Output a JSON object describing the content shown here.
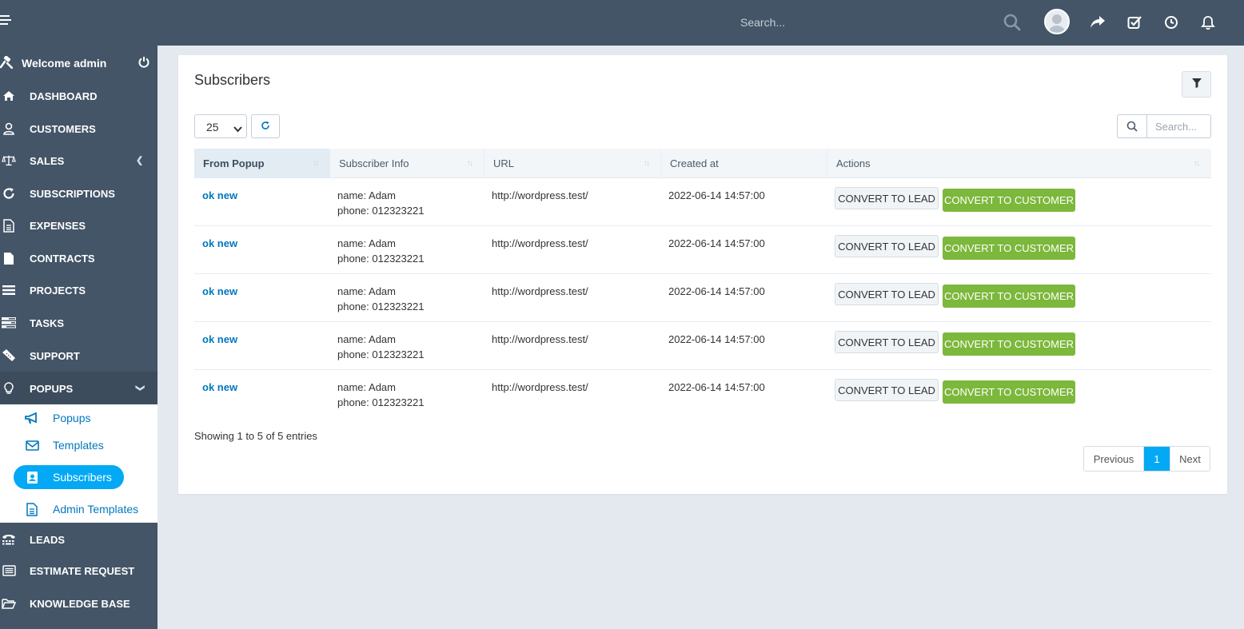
{
  "topbar": {
    "search_placeholder": "Search...",
    "icons": [
      "menu-icon",
      "search-icon",
      "share-icon",
      "check-square-icon",
      "clock-icon",
      "bell-icon"
    ]
  },
  "sidebar": {
    "welcome": "Welcome admin",
    "items": [
      {
        "label": "DASHBOARD",
        "icon": "home-icon"
      },
      {
        "label": "CUSTOMERS",
        "icon": "user-icon"
      },
      {
        "label": "SALES",
        "icon": "balance-scale-icon"
      },
      {
        "label": "SUBSCRIPTIONS",
        "icon": "refresh-icon"
      },
      {
        "label": "EXPENSES",
        "icon": "file-text-icon"
      },
      {
        "label": "CONTRACTS",
        "icon": "file-icon"
      },
      {
        "label": "PROJECTS",
        "icon": "bars-icon"
      },
      {
        "label": "TASKS",
        "icon": "tasks-icon"
      },
      {
        "label": "SUPPORT",
        "icon": "ticket-icon"
      },
      {
        "label": "POPUPS",
        "icon": "lightbulb-icon"
      },
      {
        "label": "LEADS",
        "icon": "tty-icon"
      },
      {
        "label": "ESTIMATE REQUEST",
        "icon": "list-alt-icon"
      },
      {
        "label": "KNOWLEDGE BASE",
        "icon": "folder-open-icon"
      }
    ],
    "submenu": [
      {
        "label": "Popups",
        "icon": "bullhorn-icon"
      },
      {
        "label": "Templates",
        "icon": "envelope-icon"
      },
      {
        "label": "Subscribers",
        "icon": "address-book-icon"
      },
      {
        "label": "Admin Templates",
        "icon": "file-text-icon"
      }
    ]
  },
  "panel": {
    "title": "Subscribers",
    "page_length": "25",
    "search_placeholder": "Search...",
    "columns": [
      "From Popup",
      "Subscriber Info",
      "URL",
      "Created at",
      "Actions"
    ],
    "rows": [
      {
        "popup": "ok new",
        "name": "name: Adam",
        "phone": "phone: 012323221",
        "url": "http://wordpress.test/",
        "created": "2022-06-14 14:57:00"
      },
      {
        "popup": "ok new",
        "name": "name: Adam",
        "phone": "phone: 012323221",
        "url": "http://wordpress.test/",
        "created": "2022-06-14 14:57:00"
      },
      {
        "popup": "ok new",
        "name": "name: Adam",
        "phone": "phone: 012323221",
        "url": "http://wordpress.test/",
        "created": "2022-06-14 14:57:00"
      },
      {
        "popup": "ok new",
        "name": "name: Adam",
        "phone": "phone: 012323221",
        "url": "http://wordpress.test/",
        "created": "2022-06-14 14:57:00"
      },
      {
        "popup": "ok new",
        "name": "name: Adam",
        "phone": "phone: 012323221",
        "url": "http://wordpress.test/",
        "created": "2022-06-14 14:57:00"
      }
    ],
    "actions": {
      "lead": "CONVERT TO LEAD",
      "customer": "CONVERT TO CUSTOMER"
    },
    "info": "Showing 1 to 5 of 5 entries",
    "pagination": {
      "previous": "Previous",
      "current": "1",
      "next": "Next"
    }
  },
  "colors": {
    "topbar": "#435567",
    "sidebar": "#435567",
    "accent": "#03a9f4",
    "link": "#0277bd",
    "success": "#7cb83b"
  }
}
